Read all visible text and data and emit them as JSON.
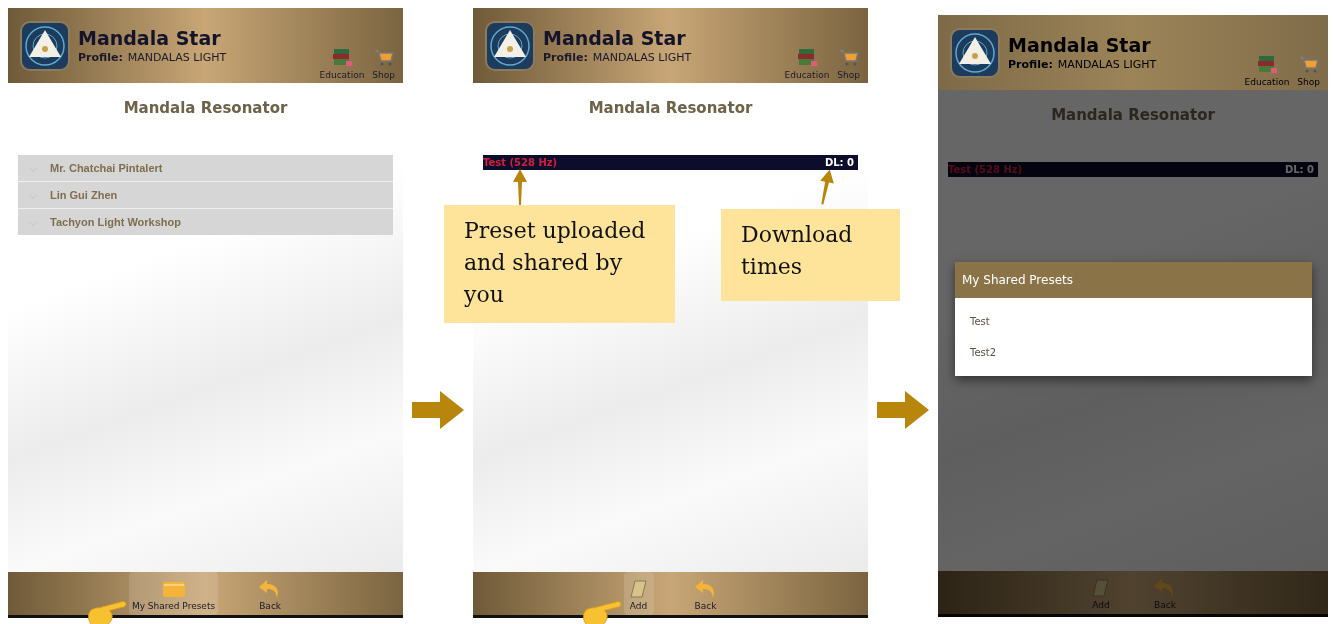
{
  "screens": [
    {
      "header": {
        "title": "Mandala Star",
        "profile_label": "Profile:",
        "profile_value": "MANDALAS LIGHT",
        "actions": [
          {
            "label": "Education"
          },
          {
            "label": "Shop"
          }
        ]
      },
      "page_title": "Mandala Resonator",
      "content": {
        "kind": "groups",
        "items": [
          "Mr. Chatchai Pintalert",
          "Lin Gui Zhen",
          "Tachyon Light Workshop"
        ]
      },
      "bottom_bar": [
        {
          "label": "My Shared Presets",
          "kind": "presets",
          "pointed": true
        },
        {
          "label": "Back",
          "kind": "back",
          "pointed": false
        }
      ],
      "dimmed": false
    },
    {
      "header": {
        "title": "Mandala Star",
        "profile_label": "Profile:",
        "profile_value": "MANDALAS LIGHT",
        "actions": [
          {
            "label": "Education"
          },
          {
            "label": "Shop"
          }
        ]
      },
      "page_title": "Mandala Resonator",
      "content": {
        "kind": "presets",
        "items": [
          {
            "name": "Test (528 Hz)",
            "downloads": "DL: 0"
          }
        ]
      },
      "bottom_bar": [
        {
          "label": "Add",
          "kind": "add",
          "pointed": true
        },
        {
          "label": "Back",
          "kind": "back",
          "pointed": false
        }
      ],
      "dimmed": false
    },
    {
      "header": {
        "title": "Mandala Star",
        "profile_label": "Profile:",
        "profile_value": "MANDALAS LIGHT",
        "actions": [
          {
            "label": "Education"
          },
          {
            "label": "Shop"
          }
        ]
      },
      "page_title": "Mandala Resonator",
      "content": {
        "kind": "presets",
        "items": [
          {
            "name": "Test (528 Hz)",
            "downloads": "DL: 0"
          }
        ]
      },
      "bottom_bar": [
        {
          "label": "Add",
          "kind": "add",
          "pointed": false
        },
        {
          "label": "Back",
          "kind": "back",
          "pointed": false
        }
      ],
      "dimmed": true,
      "dialog": {
        "title": "My Shared Presets",
        "items": [
          "Test",
          "Test2"
        ]
      }
    }
  ],
  "callouts": [
    {
      "text": "Preset uploaded and shared by you"
    },
    {
      "text": "Download times"
    }
  ]
}
